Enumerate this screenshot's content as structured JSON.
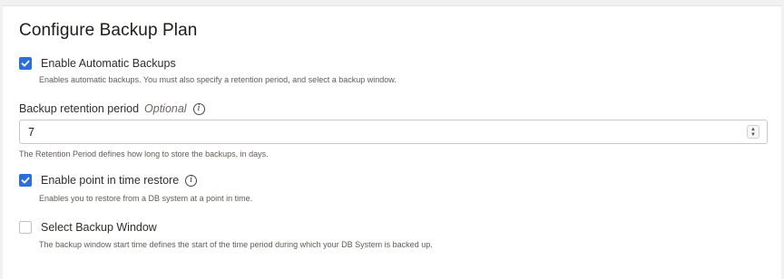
{
  "title": "Configure Backup Plan",
  "auto_backups": {
    "label": "Enable Automatic Backups",
    "checked": true,
    "help": "Enables automatic backups. You must also specify a retention period, and select a backup window."
  },
  "retention": {
    "label": "Backup retention period",
    "optional": "Optional",
    "value": "7",
    "help": "The Retention Period defines how long to store the backups, in days."
  },
  "pitr": {
    "label": "Enable point in time restore",
    "checked": true,
    "help": "Enables you to restore from a DB system at a point in time."
  },
  "backup_window": {
    "label": "Select Backup Window",
    "checked": false,
    "help": "The backup window start time defines the start of the time period during which your DB System is backed up."
  },
  "colors": {
    "accent": "#2a6fdb"
  },
  "icons": {
    "info": "info-icon",
    "check": "checkmark-icon"
  }
}
